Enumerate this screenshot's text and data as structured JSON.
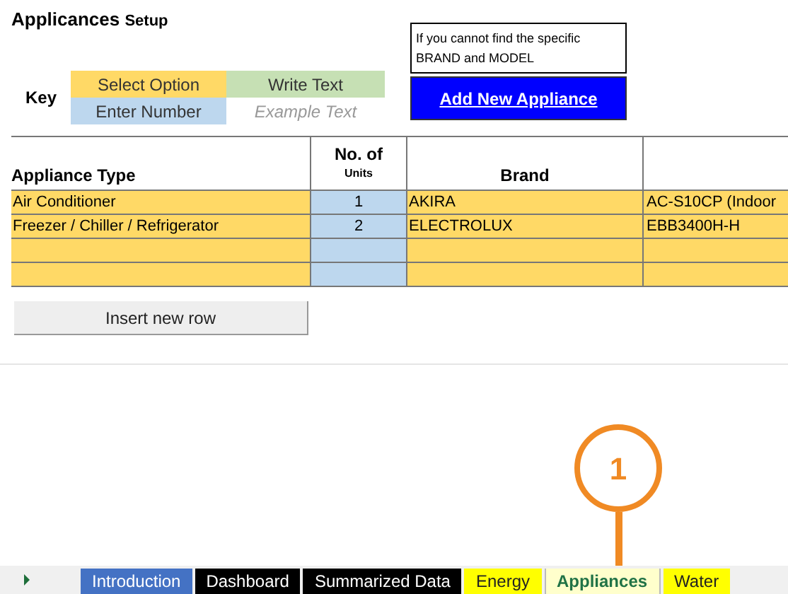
{
  "title": {
    "main": "Applicances",
    "sub": "Setup"
  },
  "key": {
    "label": "Key",
    "items": [
      {
        "text": "Select Option",
        "kind": "select"
      },
      {
        "text": "Write Text",
        "kind": "write"
      },
      {
        "text": "Enter Number",
        "kind": "number"
      },
      {
        "text": "Example Text",
        "kind": "example"
      }
    ]
  },
  "note": "If you cannot find the specific BRAND and MODEL",
  "add_button": "Add New Appliance",
  "table": {
    "columns": [
      {
        "label": "Appliance Type"
      },
      {
        "label": "No. of",
        "sublabel": "Units"
      },
      {
        "label": "Brand"
      }
    ],
    "rows": [
      {
        "type": "Air Conditioner",
        "units": "1",
        "brand": "AKIRA",
        "column_4": "AC-S10CP  (Indoor"
      },
      {
        "type": "Freezer / Chiller / Refrigerator",
        "units": "2",
        "brand": "ELECTROLUX",
        "column_4": "EBB3400H-H"
      },
      {},
      {}
    ]
  },
  "insert_button": "Insert new row",
  "callout": "1",
  "sheet_tabs": [
    {
      "label": "Introduction",
      "color": "#4472c4",
      "selected": false
    },
    {
      "label": "Dashboard",
      "color": "#000000",
      "selected": false
    },
    {
      "label": "Summarized Data",
      "color": "#000000",
      "selected": false
    },
    {
      "label": "Energy",
      "color": "#ffff00",
      "selected": false
    },
    {
      "label": "Appliances",
      "color": "#ffffcc",
      "selected": true
    },
    {
      "label": "Water",
      "color": "#ffff00",
      "selected": false
    }
  ]
}
